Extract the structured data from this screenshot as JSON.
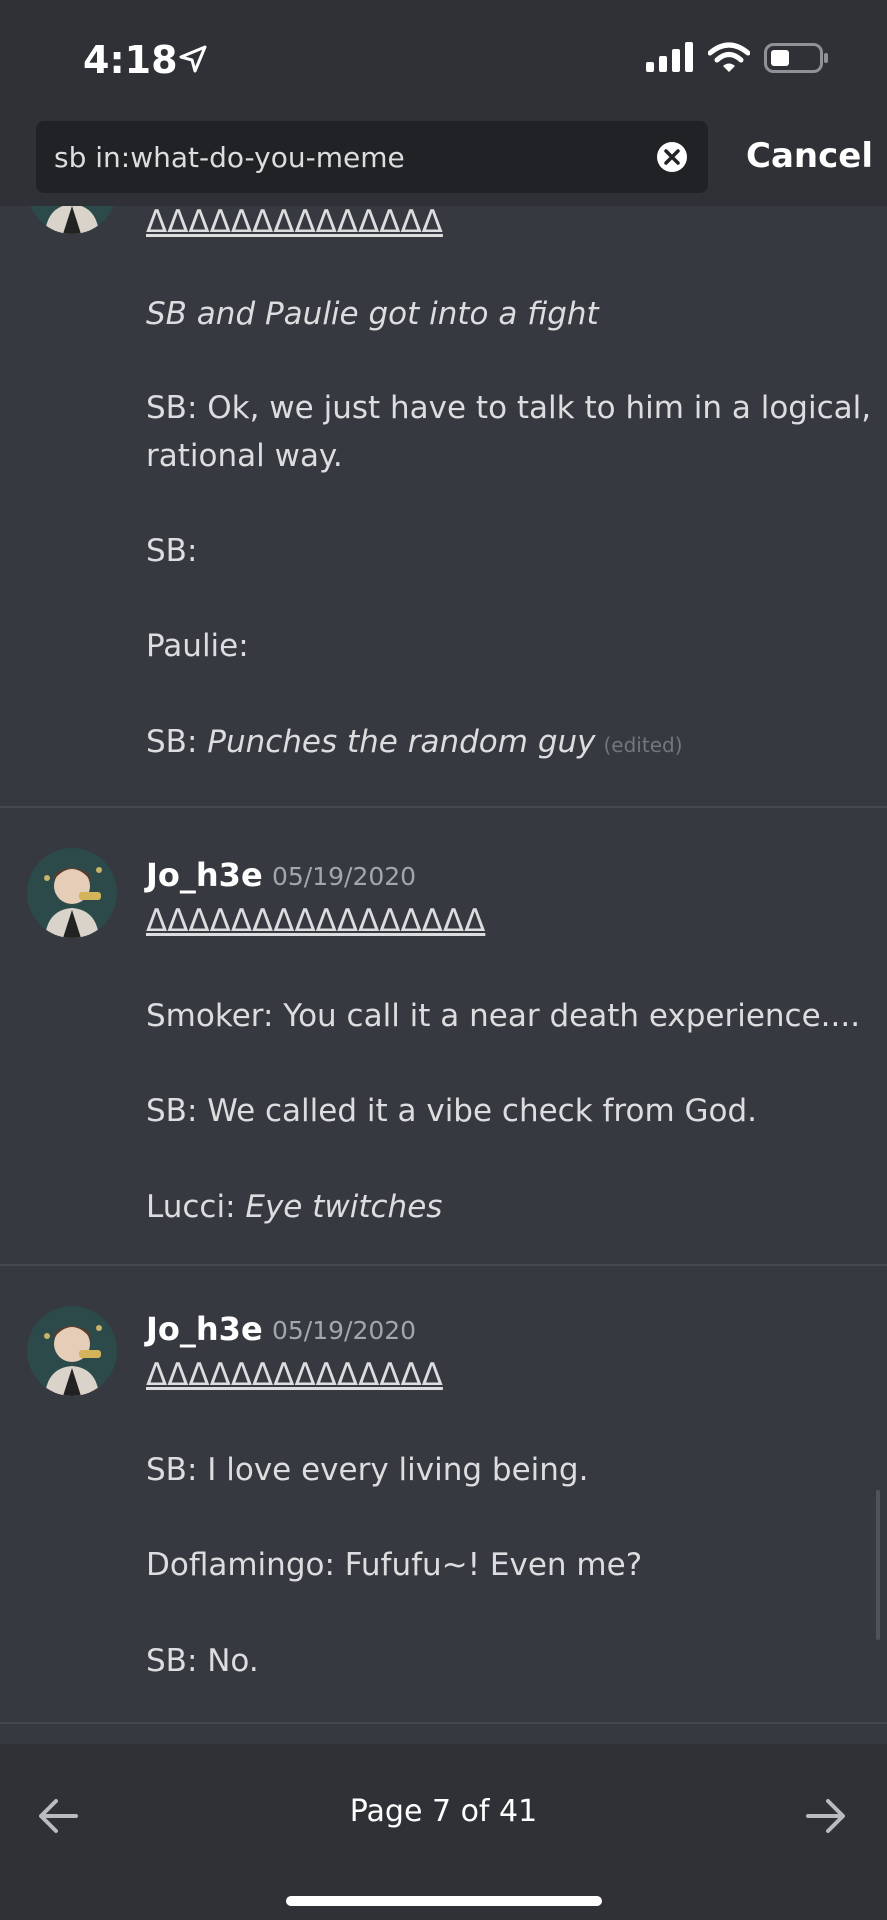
{
  "status_bar": {
    "time": "4:18"
  },
  "search": {
    "query": "sb in:what-do-you-meme",
    "cancel_label": "Cancel"
  },
  "messages": [
    {
      "deltas": "ΔΔΔΔΔΔΔΔΔΔΔΔΔΔ",
      "lines": [
        "SB and Paulie got into a fight",
        "SB: Ok, we just have to talk to him in a logical,",
        "rational way.",
        "SB:",
        "Paulie:",
        "SB: ",
        "Punches the random guy"
      ],
      "edited": "(edited)"
    },
    {
      "author": "Jo_h3e",
      "timestamp": "05/19/2020",
      "deltas": "ΔΔΔΔΔΔΔΔΔΔΔΔΔΔΔΔ",
      "lines": [
        "Smoker: You call it a near death experience....",
        "SB: We called it a vibe check from God.",
        "Lucci: ",
        "Eye twitches"
      ]
    },
    {
      "author": "Jo_h3e",
      "timestamp": "05/19/2020",
      "deltas": "ΔΔΔΔΔΔΔΔΔΔΔΔΔΔ",
      "lines": [
        "SB: I love every living being.",
        "Doflamingo: Fufufu~! Even me?",
        "SB: No."
      ]
    }
  ],
  "pagination": {
    "label": "Page 7 of 41"
  },
  "colors": {
    "background": "#36393f",
    "bar": "#2f3136",
    "search_field": "#202225",
    "text": "#dcddde",
    "muted": "#a3a6aa"
  }
}
